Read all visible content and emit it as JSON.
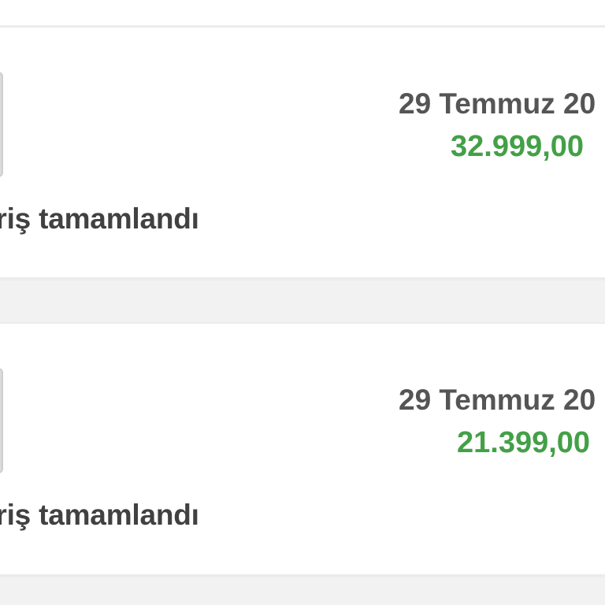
{
  "orders": [
    {
      "date": "29 Temmuz 20",
      "price": "32.999,00",
      "status": "ariş tamamlandı"
    },
    {
      "date": "29 Temmuz 20",
      "price": "21.399,00",
      "status": "ariş tamamlandı"
    }
  ],
  "colors": {
    "price": "#43a047",
    "status_text": "#414141",
    "date_text": "#555555",
    "card_background": "#ffffff",
    "page_background": "#f2f2f2",
    "thumbnail_accent": "#c9e05a"
  }
}
